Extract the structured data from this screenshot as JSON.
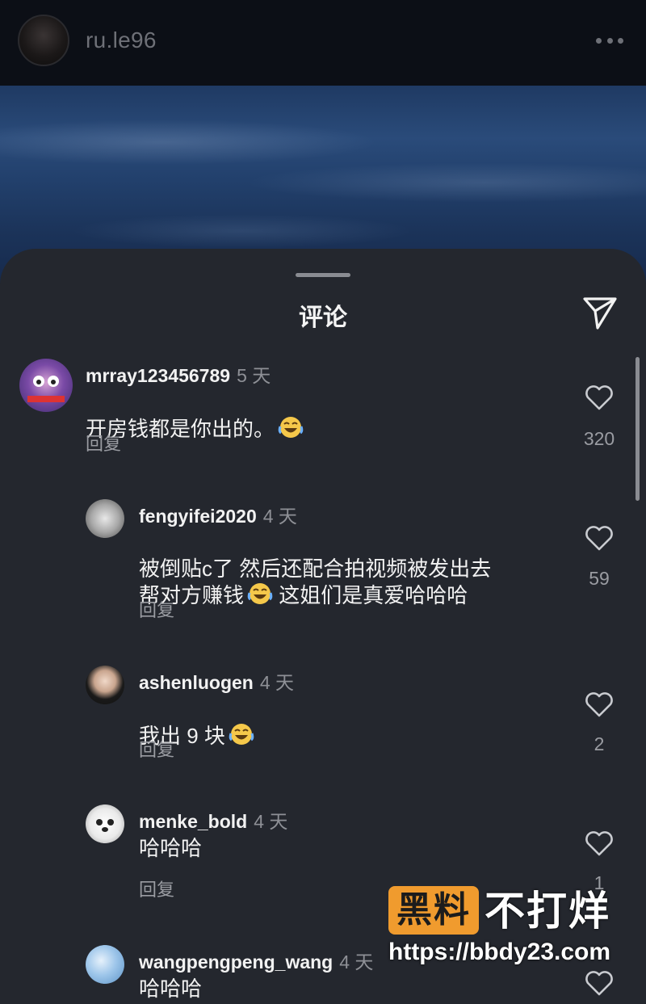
{
  "header": {
    "username": "ru.le96"
  },
  "sheet": {
    "title": "评论"
  },
  "comments": [
    {
      "username": "mrray123456789",
      "time": "5 天",
      "text": "开房钱都是你出的。",
      "emoji": true,
      "reply": "回复",
      "likes": "320"
    },
    {
      "username": "fengyifei2020",
      "time": "4 天",
      "text_line1": "被倒贴c了  然后还配合拍视频被发出去",
      "text_line2a": "帮对方赚钱",
      "text_line2b": "  这姐们是真爱哈哈哈",
      "reply": "回复",
      "likes": "59"
    },
    {
      "username": "ashenluogen",
      "time": "4 天",
      "text": "我出 9 块",
      "emoji": true,
      "reply": "回复",
      "likes": "2"
    },
    {
      "username": "menke_bold",
      "time": "4 天",
      "text": "哈哈哈",
      "reply": "回复",
      "likes": "1"
    },
    {
      "username": "wangpengpeng_wang",
      "time": "4 天",
      "text": "哈哈哈"
    }
  ],
  "watermark": {
    "badge": "黑料",
    "title": "不打烊",
    "url": "https://bbdy23.com"
  },
  "colors": {
    "sheet_bg": "#24272e",
    "watermark_orange": "#f09b2e"
  }
}
